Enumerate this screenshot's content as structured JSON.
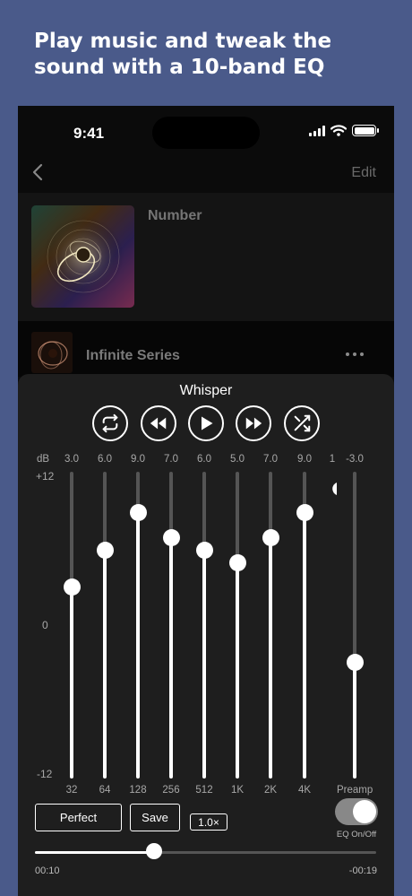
{
  "headline": "Play music and tweak the sound with a 10-band EQ",
  "status_bar": {
    "time": "9:41"
  },
  "nav": {
    "edit_label": "Edit"
  },
  "album": {
    "title": "Number"
  },
  "track": {
    "title": "Infinite Series"
  },
  "eq": {
    "preset_name": "Whisper",
    "db_label": "dB",
    "scale": {
      "top": "+12",
      "mid": "0",
      "bottom": "-12"
    },
    "range": [
      -12,
      12
    ],
    "bands": [
      {
        "freq": "32",
        "gain": "3.0",
        "value": 3.0
      },
      {
        "freq": "64",
        "gain": "6.0",
        "value": 6.0
      },
      {
        "freq": "128",
        "gain": "9.0",
        "value": 9.0
      },
      {
        "freq": "256",
        "gain": "7.0",
        "value": 7.0
      },
      {
        "freq": "512",
        "gain": "6.0",
        "value": 6.0
      },
      {
        "freq": "1K",
        "gain": "5.0",
        "value": 5.0
      },
      {
        "freq": "2K",
        "gain": "7.0",
        "value": 7.0
      },
      {
        "freq": "4K",
        "gain": "9.0",
        "value": 9.0
      }
    ],
    "partial_band": {
      "gain_fragment": "1"
    },
    "preamp": {
      "label": "Preamp",
      "gain": "-3.0",
      "value": -3.0
    },
    "buttons": {
      "preset": "Perfect",
      "save": "Save",
      "speed": "1.0×"
    },
    "toggle": {
      "label": "EQ On/Off",
      "on": true
    }
  },
  "playback": {
    "elapsed": "00:10",
    "remaining": "-00:19",
    "progress": 0.35
  },
  "colors": {
    "background": "#4a5a8a",
    "panel": "#1e1e1e",
    "accent": "#ffffff"
  }
}
